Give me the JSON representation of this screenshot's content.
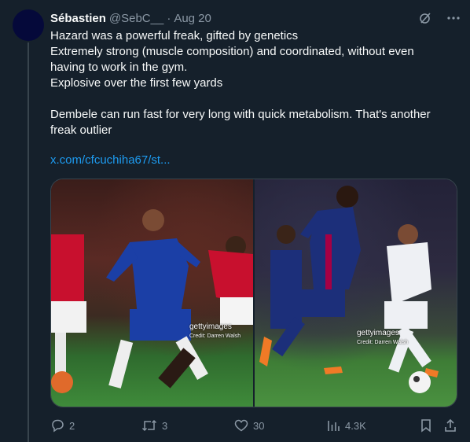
{
  "tweet": {
    "author_name": "Sébastien",
    "author_handle": "@SebC__",
    "separator": "·",
    "date": "Aug 20",
    "lines": [
      "Hazard was a powerful freak, gifted by genetics",
      "Extremely strong (muscle composition) and coordinated, without even having to work in the gym.",
      "Explosive over the first few yards",
      "Dembele can run fast for very long with quick metabolism. That's another freak outlier"
    ],
    "link_text": "x.com/cfcuchiha67/st...",
    "media": [
      {
        "watermark": "gettyimages",
        "credit": "Credit: Darren Walsh"
      },
      {
        "watermark": "gettyimages",
        "credit": "Credit: Darren Walsh"
      }
    ]
  },
  "actions": {
    "replies": "2",
    "reposts": "3",
    "likes": "30",
    "views": "4.3K"
  },
  "icons": {
    "grok": "grok-icon",
    "more": "more-icon",
    "reply": "reply-icon",
    "repost": "repost-icon",
    "like": "heart-icon",
    "views": "views-icon",
    "bookmark": "bookmark-icon",
    "share": "share-icon"
  }
}
